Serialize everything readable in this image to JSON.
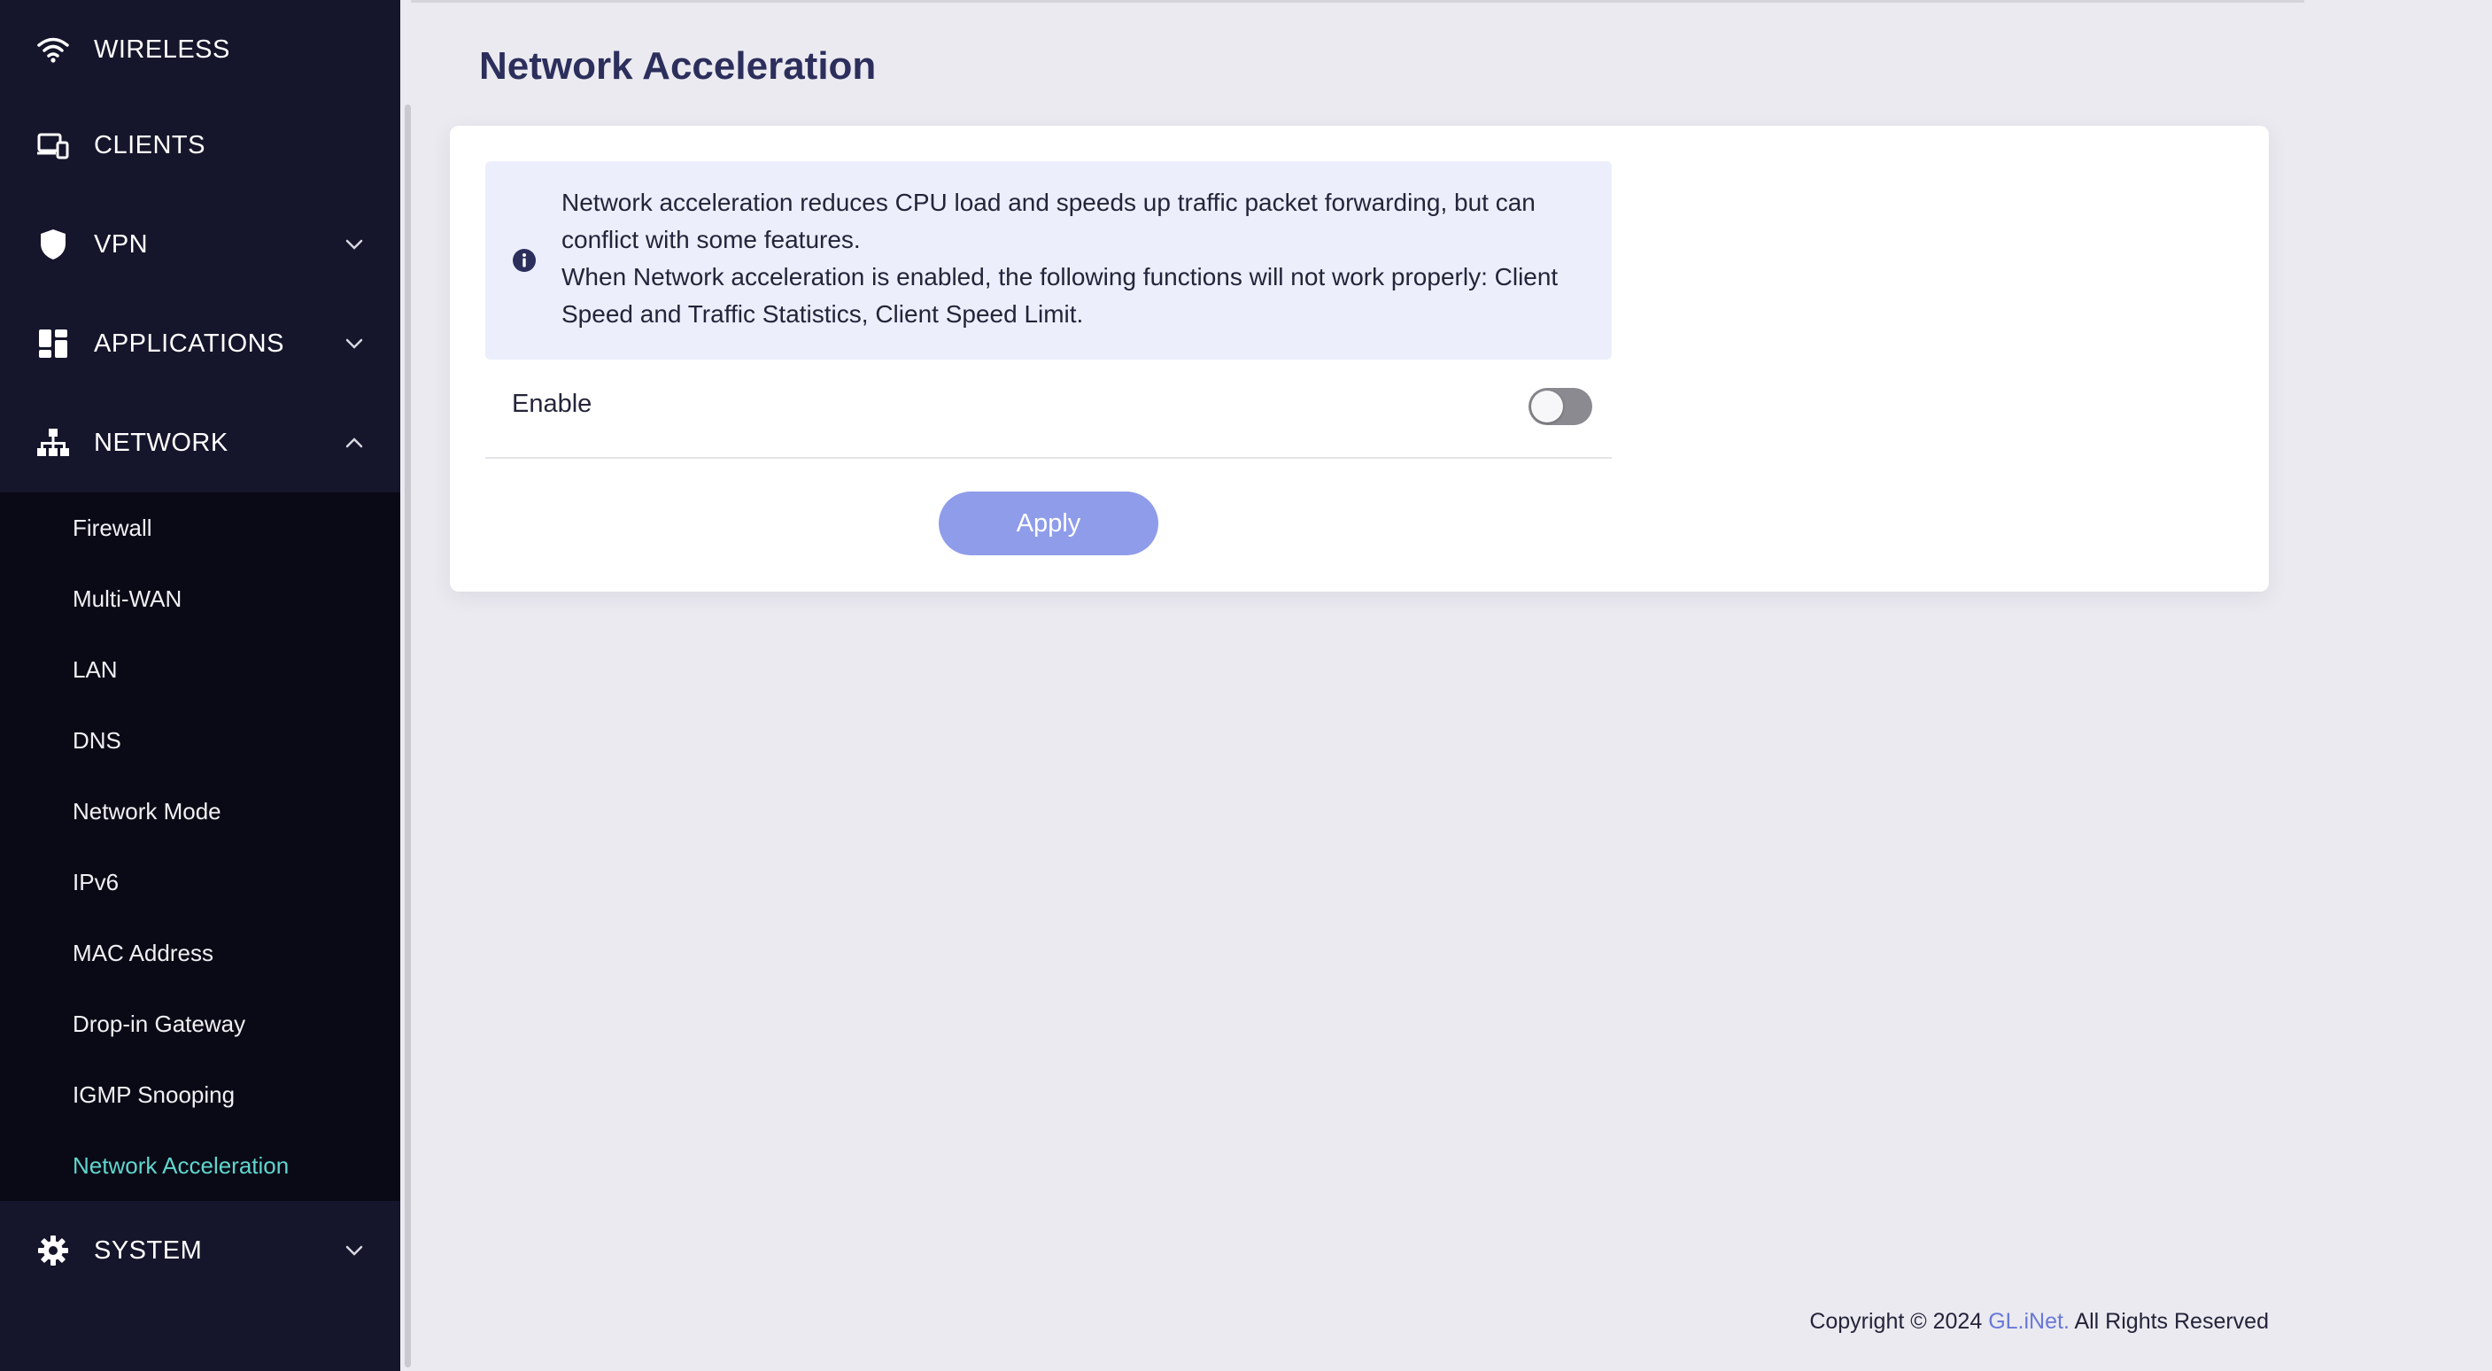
{
  "sidebar": {
    "items": [
      {
        "label": "WIRELESS",
        "icon": "wifi-icon"
      },
      {
        "label": "CLIENTS",
        "icon": "devices-icon"
      },
      {
        "label": "VPN",
        "icon": "shield-icon",
        "chevron": "down"
      },
      {
        "label": "APPLICATIONS",
        "icon": "apps-grid-icon",
        "chevron": "down"
      },
      {
        "label": "NETWORK",
        "icon": "network-tree-icon",
        "chevron": "up"
      },
      {
        "label": "SYSTEM",
        "icon": "gear-icon",
        "chevron": "down"
      }
    ],
    "network_submenu": [
      "Firewall",
      "Multi-WAN",
      "LAN",
      "DNS",
      "Network Mode",
      "IPv6",
      "MAC Address",
      "Drop-in Gateway",
      "IGMP Snooping",
      "Network Acceleration"
    ],
    "active_submenu": "Network Acceleration"
  },
  "main": {
    "title": "Network Acceleration",
    "notice": {
      "line1": "Network acceleration reduces CPU load and speeds up traffic packet forwarding, but can conflict with some features.",
      "line2": "When Network acceleration is enabled, the following functions will not work properly: Client Speed and Traffic Statistics, Client Speed Limit."
    },
    "enable_label": "Enable",
    "enable_state": "off",
    "apply_label": "Apply"
  },
  "footer": {
    "prefix": "Copyright © 2024 ",
    "brand": "GL.iNet.",
    "suffix": " All Rights Reserved"
  },
  "colors": {
    "sidebar_bg": "#15152b",
    "submenu_bg": "#0a0a16",
    "active_item": "#5fd6cd",
    "title": "#2c2f5c",
    "notice_bg": "#eceffb",
    "apply_button": "#8f9cea",
    "brand_link": "#6878d8"
  }
}
